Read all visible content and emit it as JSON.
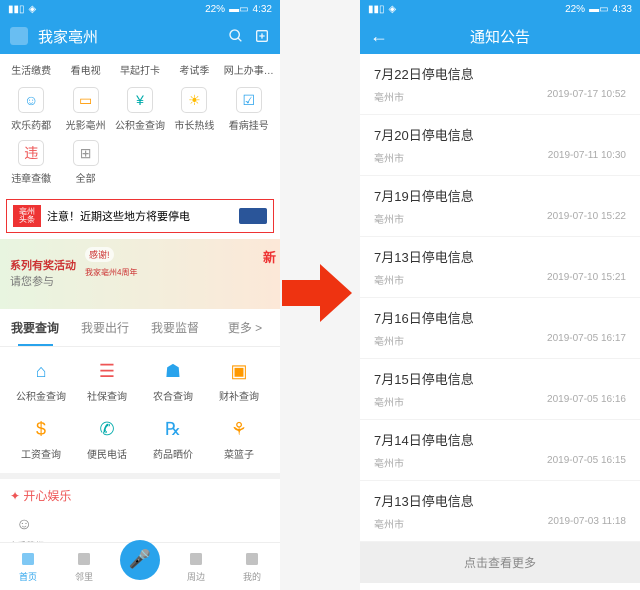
{
  "status": {
    "battery": "22%",
    "time_left": "4:32",
    "time_right": "4:33"
  },
  "app": {
    "title": "我家亳州"
  },
  "top_cats": [
    {
      "label": "生活缴费"
    },
    {
      "label": "看电视"
    },
    {
      "label": "早起打卡"
    },
    {
      "label": "考试季"
    },
    {
      "label": "网上办事…"
    }
  ],
  "mid_cats": [
    {
      "label": "欢乐药都",
      "cls": "c-blue",
      "g": "☺"
    },
    {
      "label": "光影亳州",
      "cls": "c-orange",
      "g": "▭"
    },
    {
      "label": "公积金查询",
      "cls": "c-teal",
      "g": "¥"
    },
    {
      "label": "市长热线",
      "cls": "c-yellow",
      "g": "☀"
    },
    {
      "label": "看病挂号",
      "cls": "c-blue",
      "g": "☑"
    },
    {
      "label": "违章查徽",
      "cls": "c-red",
      "g": "违"
    },
    {
      "label": "全部",
      "cls": "c-gray",
      "g": "⊞"
    }
  ],
  "banner": {
    "logo_t": "亳州",
    "logo_b": "头条",
    "text": "注意！近期这些地方将要停电"
  },
  "promo": {
    "l1": "系列有奖活动",
    "l2": "请您参与",
    "badge": "感谢!",
    "anniv": "我家亳州4周年",
    "new": "新"
  },
  "tabs": [
    {
      "label": "我要查询",
      "active": true
    },
    {
      "label": "我要出行",
      "active": false
    },
    {
      "label": "我要监督",
      "active": false
    },
    {
      "label": "更多 >",
      "active": false
    }
  ],
  "services": [
    {
      "label": "公积金查询",
      "cls": "c-blue",
      "g": "⌂"
    },
    {
      "label": "社保查询",
      "cls": "c-red",
      "g": "☰"
    },
    {
      "label": "农合查询",
      "cls": "c-blue",
      "g": "☗"
    },
    {
      "label": "财补查询",
      "cls": "c-orange",
      "g": "▣"
    },
    {
      "label": "工资查询",
      "cls": "c-orange",
      "g": "$"
    },
    {
      "label": "便民电话",
      "cls": "c-teal",
      "g": "✆"
    },
    {
      "label": "药品晒价",
      "cls": "c-blue",
      "g": "℞"
    },
    {
      "label": "菜篮子",
      "cls": "c-orange",
      "g": "⚘"
    }
  ],
  "section": "✦ 开心娱乐",
  "subrow": [
    {
      "label": "欢乐药都"
    }
  ],
  "nav": [
    {
      "label": "首页",
      "active": true
    },
    {
      "label": "邻里"
    },
    {
      "label": ""
    },
    {
      "label": "周边"
    },
    {
      "label": "我的"
    }
  ],
  "right": {
    "title": "通知公告",
    "items": [
      {
        "title": "7月22日停电信息",
        "loc": "亳州市",
        "time": "2019-07-17 10:52"
      },
      {
        "title": "7月20日停电信息",
        "loc": "亳州市",
        "time": "2019-07-11 10:30"
      },
      {
        "title": "7月19日停电信息",
        "loc": "亳州市",
        "time": "2019-07-10 15:22"
      },
      {
        "title": "7月13日停电信息",
        "loc": "亳州市",
        "time": "2019-07-10 15:21"
      },
      {
        "title": "7月16日停电信息",
        "loc": "亳州市",
        "time": "2019-07-05 16:17"
      },
      {
        "title": "7月15日停电信息",
        "loc": "亳州市",
        "time": "2019-07-05 16:16"
      },
      {
        "title": "7月14日停电信息",
        "loc": "亳州市",
        "time": "2019-07-05 16:15"
      },
      {
        "title": "7月13日停电信息",
        "loc": "亳州市",
        "time": "2019-07-03 11:18"
      }
    ],
    "more": "点击查看更多"
  }
}
